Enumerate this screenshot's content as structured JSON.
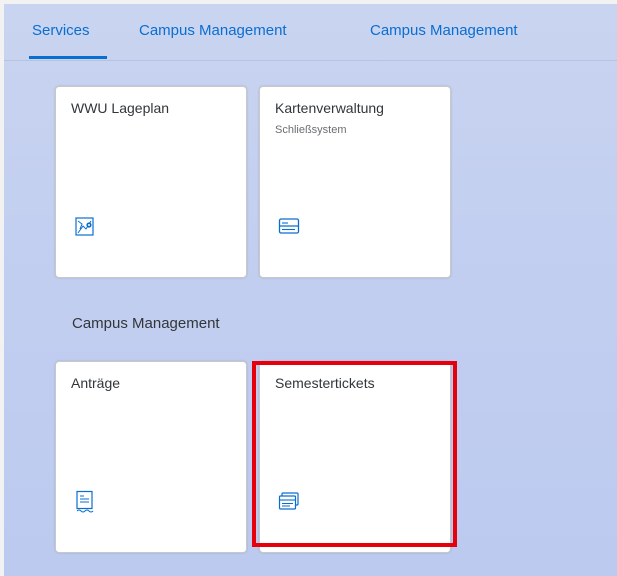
{
  "tabs": [
    {
      "label": "Services",
      "active": true
    },
    {
      "label": "Campus Management"
    },
    {
      "label": "Campus Management"
    }
  ],
  "groups": [
    {
      "title": "",
      "tiles": [
        {
          "title": "WWU Lageplan",
          "subtitle": "",
          "icon": "map-icon"
        },
        {
          "title": "Kartenverwaltung",
          "subtitle": "Schließsystem",
          "icon": "id-card-icon"
        }
      ]
    },
    {
      "title": "Campus Management",
      "tiles": [
        {
          "title": "Anträge",
          "subtitle": "",
          "icon": "document-icon"
        },
        {
          "title": "Semestertickets",
          "subtitle": "",
          "icon": "tickets-icon",
          "highlighted": true
        }
      ]
    }
  ],
  "colors": {
    "accent": "#0a6ed1",
    "highlight": "#e6000b",
    "background": "#c3cff0"
  }
}
